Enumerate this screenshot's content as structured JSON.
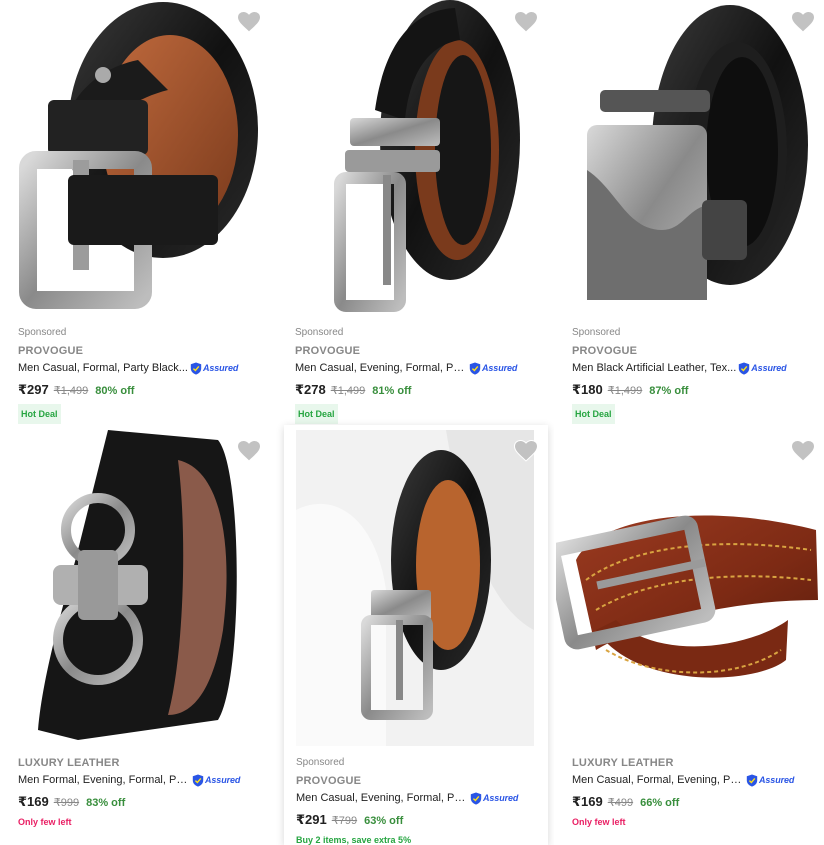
{
  "colors": {
    "price_green": "#388e3c",
    "tag_bg": "#e8f7ec",
    "few_left": "#e91e63",
    "assured_blue": "#2a55e5"
  },
  "products": [
    {
      "sponsored": "Sponsored",
      "brand": "PROVOGUE",
      "title": "Men Casual, Formal, Party Black...",
      "assured": "Assured",
      "price": "₹297",
      "mrp": "₹1,499",
      "off": "80% off",
      "tag": "Hot Deal",
      "wishlist_icon": "heart-icon"
    },
    {
      "sponsored": "Sponsored",
      "brand": "PROVOGUE",
      "title": "Men Casual, Evening, Formal, Pa...",
      "assured": "Assured",
      "price": "₹278",
      "mrp": "₹1,499",
      "off": "81% off",
      "tag": "Hot Deal",
      "wishlist_icon": "heart-icon"
    },
    {
      "sponsored": "Sponsored",
      "brand": "PROVOGUE",
      "title": "Men Black Artificial Leather, Tex...",
      "assured": "Assured",
      "price": "₹180",
      "mrp": "₹1,499",
      "off": "87% off",
      "tag": "Hot Deal",
      "wishlist_icon": "heart-icon"
    },
    {
      "sponsored": "",
      "brand": "LUXURY LEATHER",
      "title": "Men Formal, Evening, Formal, Pa...",
      "assured": "Assured",
      "price": "₹169",
      "mrp": "₹999",
      "off": "83% off",
      "note": "Only few left",
      "wishlist_icon": "heart-icon"
    },
    {
      "sponsored": "Sponsored",
      "brand": "PROVOGUE",
      "title": "Men Casual, Evening, Formal, Pa...",
      "assured": "Assured",
      "price": "₹291",
      "mrp": "₹799",
      "off": "63% off",
      "offer": "Buy 2 items, save extra 5%",
      "wishlist_icon": "heart-icon"
    },
    {
      "sponsored": "",
      "brand": "LUXURY LEATHER",
      "title": "Men Casual, Formal, Evening, Pa...",
      "assured": "Assured",
      "price": "₹169",
      "mrp": "₹499",
      "off": "66% off",
      "note": "Only few left",
      "wishlist_icon": "heart-icon"
    }
  ]
}
